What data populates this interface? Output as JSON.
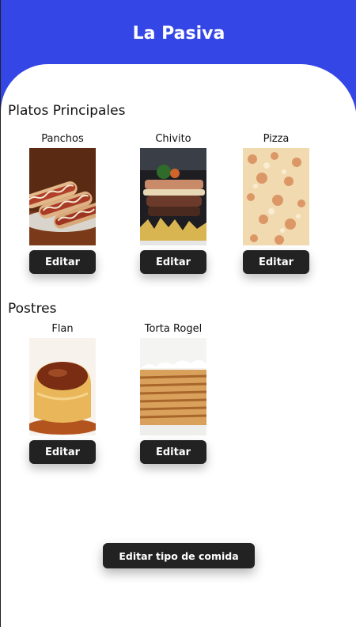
{
  "app": {
    "title": "La Pasiva"
  },
  "sections": [
    {
      "title": "Platos Principales",
      "items": [
        {
          "name": "Panchos",
          "button": "Editar",
          "image": "hotdog-photo"
        },
        {
          "name": "Chivito",
          "button": "Editar",
          "image": "chivito-photo"
        },
        {
          "name": "Pizza",
          "button": "Editar",
          "image": "pizza-photo"
        }
      ]
    },
    {
      "title": "Postres",
      "items": [
        {
          "name": "Flan",
          "button": "Editar",
          "image": "flan-photo"
        },
        {
          "name": "Torta Rogel",
          "button": "Editar",
          "image": "cake-photo"
        }
      ]
    }
  ],
  "footer": {
    "edit_type_label": "Editar tipo de comida"
  },
  "colors": {
    "header": "#3446e6",
    "button": "#222222",
    "button_text": "#ffffff"
  }
}
